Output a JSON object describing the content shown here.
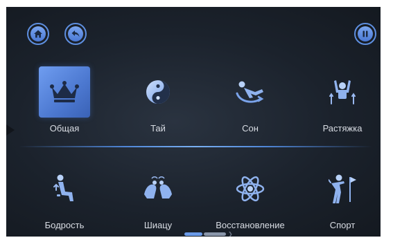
{
  "header": {
    "home_icon": "home-icon",
    "back_icon": "back-arrow-icon",
    "pause_icon": "pause-icon"
  },
  "modes_row1": [
    {
      "label": "Общая",
      "icon": "crown-icon",
      "active": true
    },
    {
      "label": "Тай",
      "icon": "yin-yang-icon",
      "active": false
    },
    {
      "label": "Сон",
      "icon": "sleep-recline-icon",
      "active": false
    },
    {
      "label": "Растяжка",
      "icon": "stretch-icon",
      "active": false
    }
  ],
  "modes_row2": [
    {
      "label": "Бодрость",
      "icon": "seated-person-icon",
      "active": false
    },
    {
      "label": "Шиацу",
      "icon": "shiatsu-hands-icon",
      "active": false
    },
    {
      "label": "Восстановление",
      "icon": "atom-icon",
      "active": false
    },
    {
      "label": "Спорт",
      "icon": "golf-icon",
      "active": false
    }
  ],
  "pager": {
    "current": 1,
    "total": 2
  },
  "colors": {
    "accent": "#5e8fe0",
    "background": "#1b222c",
    "label": "#d9dde4"
  }
}
